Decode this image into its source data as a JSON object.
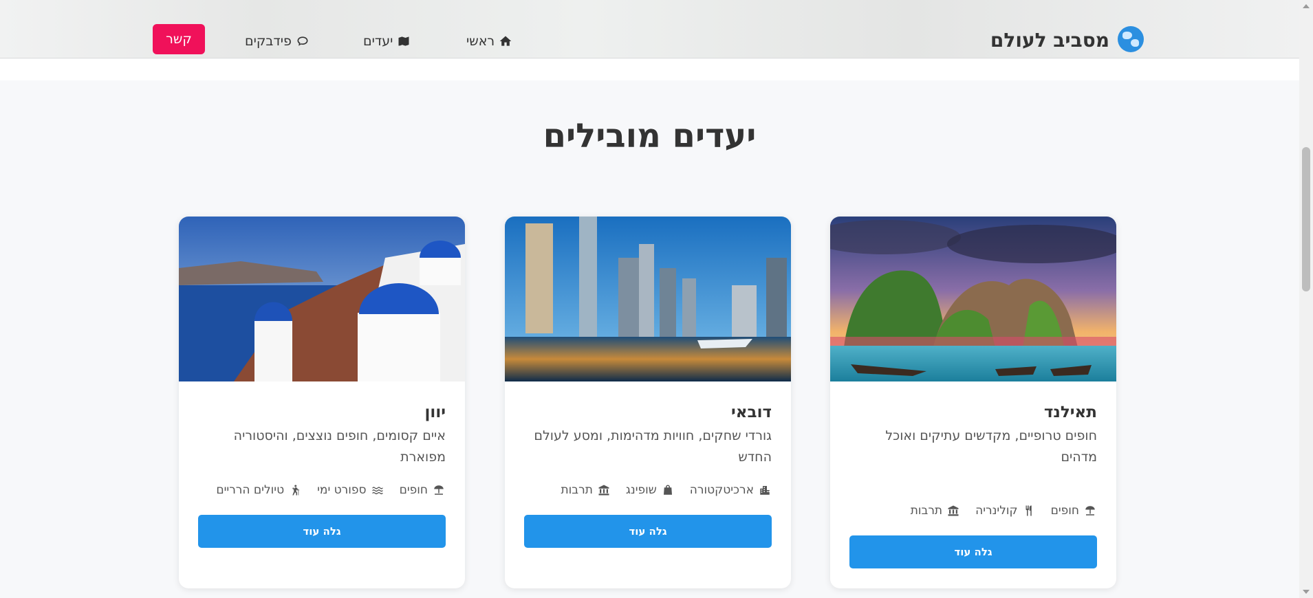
{
  "header": {
    "logo_text": "מסביב לעולם",
    "nav": {
      "home": "ראשי",
      "destinations": "יעדים",
      "feedback": "פידבקים"
    },
    "contact_label": "קשר"
  },
  "section": {
    "title": "יעדים מובילים"
  },
  "cards": [
    {
      "title": "תאילנד",
      "description": "חופים טרופיים, מקדשים עתיקים ואוכל מדהים",
      "tags": [
        "חופים",
        "קולינריה",
        "תרבות"
      ],
      "button": "גלה עוד"
    },
    {
      "title": "דובאי",
      "description": "גורדי שחקים, חוויות מדהימות, ומסע לעולם החדש",
      "tags": [
        "ארכיטקטורה",
        "שופינג",
        "תרבות"
      ],
      "button": "גלה עוד"
    },
    {
      "title": "יוון",
      "description": "איים קסומים, חופים נוצצים, והיסטוריה מפוארת",
      "tags": [
        "חופים",
        "ספורט ימי",
        "טיולים הרריים"
      ],
      "button": "גלה עוד"
    }
  ],
  "colors": {
    "accent": "#2294ea",
    "contact": "#f0115a"
  }
}
